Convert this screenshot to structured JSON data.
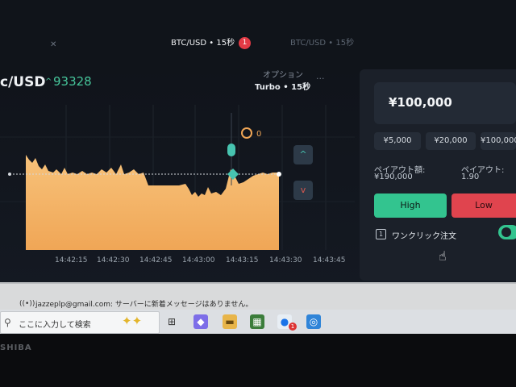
{
  "tabs": {
    "active_label": "BTC/USD • 15秒",
    "active_badge": "1",
    "inactive_label": "BTC/USD • 15秒"
  },
  "asset": {
    "pair": "c/USD",
    "price_arrow": "^",
    "price": "93328"
  },
  "option": {
    "label": "オプション",
    "mode": "Turbo • 15秒",
    "more": "..."
  },
  "chart": {
    "marker_count": "0",
    "current_price_line": "93328",
    "time_labels": [
      "14:42:15",
      "14:42:30",
      "14:42:45",
      "14:43:00",
      "14:43:15",
      "14:43:30",
      "14:43:45"
    ],
    "colors": {
      "area_top": "#f7c27a",
      "area_bottom": "#f0a656",
      "up": "#47c4b0",
      "down": "#d9584f"
    }
  },
  "controls": {
    "up_label": "^",
    "down_label": "v"
  },
  "trade_panel": {
    "amount": "¥100,000",
    "plus_label": "+",
    "presets": [
      "¥5,000",
      "¥20,000",
      "¥100,000"
    ],
    "payout_amount_title": "ペイアウト額:",
    "payout_amount_value": "¥190,000",
    "payout_title": "ペイアウト:",
    "payout_value": "1.90",
    "high_label": "High",
    "low_label": "Low",
    "one_click_label": "ワンクリック注文",
    "one_click_enabled": true
  },
  "notification": {
    "text": "jazzeplp@gmail.com: サーバーに新着メッセージはありません。"
  },
  "taskbar": {
    "search_placeholder": "ここに入力して検索",
    "notification_badge": "1"
  },
  "bezel": {
    "logo": "SHIBA"
  }
}
